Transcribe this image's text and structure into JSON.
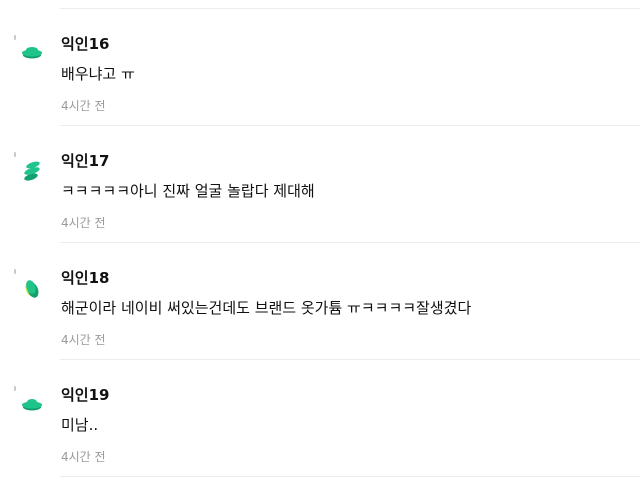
{
  "comments": [
    {
      "nickname": "익인16",
      "text": "배우냐고 ㅠ",
      "time": "4시간 전"
    },
    {
      "nickname": "익인17",
      "text": "ㅋㅋㅋㅋㅋ아니 진짜 얼굴 놀랍다 제대해",
      "time": "4시간 전"
    },
    {
      "nickname": "익인18",
      "text": "해군이라 네이비 써있는건데도 브랜드 옷가튬 ㅠㅋㅋㅋㅋ잘생겼다",
      "time": "4시간 전"
    },
    {
      "nickname": "익인19",
      "text": "미남..",
      "time": "4시간 전"
    }
  ],
  "colors": {
    "avatar_green": "#1ec48a",
    "avatar_dark_green": "#13a06c",
    "avatar_lime": "#b8e04a",
    "avatar_tick": "#c9c9c9",
    "nickname": "#111111",
    "time": "#9a9a9a",
    "divider": "#ececec"
  }
}
